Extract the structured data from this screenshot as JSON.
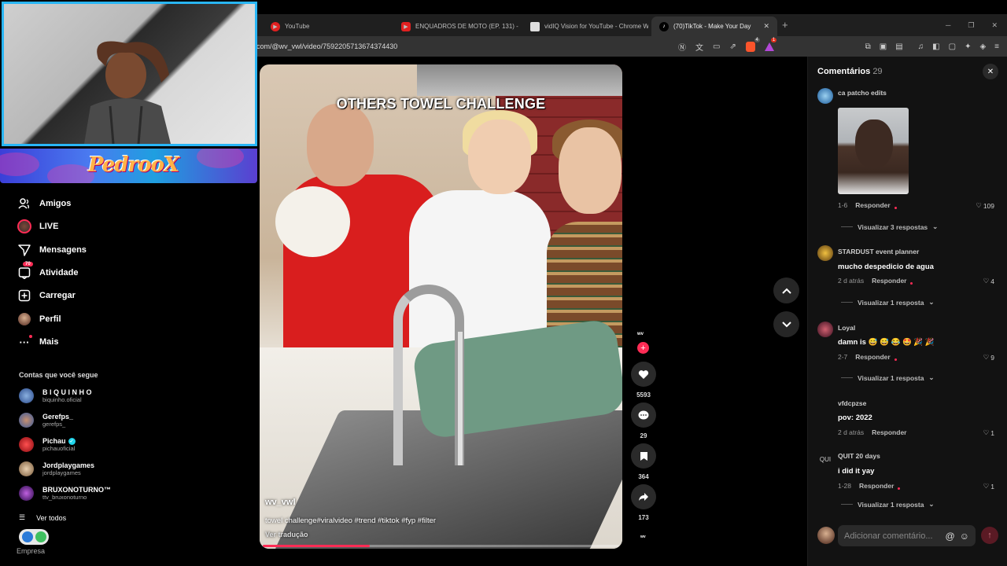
{
  "browser": {
    "tabs": [
      {
        "label": "YouTube",
        "active": false
      },
      {
        "label": "ENQUADROS DE MOTO (EP. 131) - Yo",
        "active": false
      },
      {
        "label": "vidIQ Vision for YouTube - Chrome W",
        "active": false
      },
      {
        "label": "(70)TikTok - Make Your Day",
        "active": true
      }
    ],
    "url": "com/@wv_vwl/video/7592205713674374430",
    "brave_badge": "4",
    "rewards_badge": "1"
  },
  "overlay": {
    "banner_text": "PedrooX"
  },
  "sidebar": {
    "items": [
      {
        "label": "Amigos",
        "icon": "friends-icon"
      },
      {
        "label": "LIVE",
        "icon": "live-icon"
      },
      {
        "label": "Mensagens",
        "icon": "send-icon"
      },
      {
        "label": "Atividade",
        "icon": "inbox-icon",
        "badge": "70"
      },
      {
        "label": "Carregar",
        "icon": "upload-icon"
      },
      {
        "label": "Perfil",
        "icon": "profile-avatar"
      },
      {
        "label": "Mais",
        "icon": "more-icon"
      }
    ],
    "following_title": "Contas que você segue",
    "following": [
      {
        "name": "B I Q U I N H O",
        "handle": "biquinho.oficial",
        "color": "#3a5c9a"
      },
      {
        "name": "Gerefps_",
        "handle": "gerefps_",
        "color": "#5a7ab0"
      },
      {
        "name": "Pichau",
        "handle": "pichauoficial",
        "verified": true,
        "color": "#e0202a"
      },
      {
        "name": "Jordplaygames",
        "handle": "jordplaygames",
        "color": "#c8a27a"
      },
      {
        "name": "BRUXONOTURNO™",
        "handle": "ttv_bruxonoturno",
        "color": "#6a3aa0"
      }
    ],
    "see_all": "Ver todos",
    "empresa": "Empresa"
  },
  "video": {
    "overlay_title": "OTHERS TOWEL CHALLENGE",
    "author": "wv_vwl",
    "description": "towel challenge#viralvideo #trend #tiktok #fyp #filter",
    "translate": "Ver tradução",
    "progress": 0.3
  },
  "actions": {
    "avatar_text": "wv",
    "likes": "5593",
    "comments": "29",
    "saves": "364",
    "shares": "173",
    "bottom_text": "wv"
  },
  "comments_panel": {
    "title": "Comentários",
    "count": "29",
    "input_placeholder": "Adicionar comentário...",
    "comments": [
      {
        "user": "ca patcho edits",
        "text": "",
        "date": "1-6",
        "reply": "Responder",
        "likes": "109",
        "view_replies": "Visualizar 3 respostas",
        "avatar_color": "#3a7ab0"
      },
      {
        "user": "STARDUST event planner",
        "text": "mucho despedicio de agua",
        "date": "2 d atrás",
        "reply": "Responder",
        "likes": "4",
        "view_replies": "Visualizar 1 resposta",
        "avatar_color": "#8a6a2a"
      },
      {
        "user": "Loyal",
        "text": "damn is 😅 😅 😂 🤩 🎉 🎉",
        "date": "2-7",
        "reply": "Responder",
        "likes": "9",
        "view_replies": "Visualizar 1 resposta",
        "avatar_color": "#8a2a3a"
      },
      {
        "user": "vfdcpzse",
        "text": "pov: 2022",
        "date": "2 d atrás",
        "reply": "Responder",
        "likes": "1",
        "view_replies": "",
        "avatar_color": "#121212"
      },
      {
        "user": "QUIT 20 days",
        "text": "i did it yay",
        "date": "1-28",
        "reply": "Responder",
        "likes": "1",
        "view_replies": "Visualizar 1 resposta",
        "avatar_label": "QUI",
        "avatar_color": "#121212"
      }
    ]
  }
}
